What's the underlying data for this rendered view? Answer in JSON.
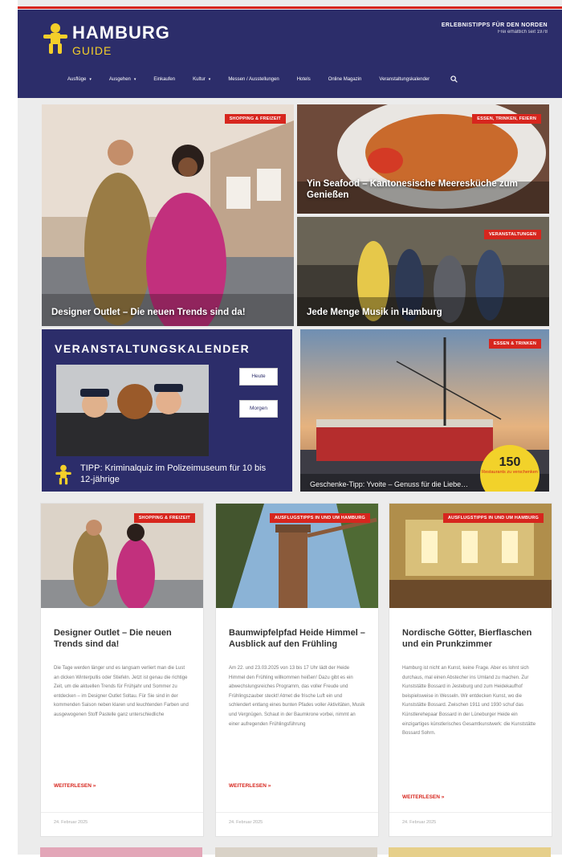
{
  "brand": {
    "name": "HAMBURG",
    "sub": "GUIDE",
    "tagline": "ERLEBNISTIPPS FÜR DEN NORDEN",
    "tagline_sub": "Frei erhältlich seit 1978"
  },
  "nav": {
    "items": [
      "Ausflüge",
      "Ausgehen",
      "Einkaufen",
      "Kultur",
      "Messen / Ausstellungen",
      "Hotels",
      "Online Magazin",
      "Veranstaltungskalender"
    ],
    "dropdown": [
      true,
      true,
      false,
      true,
      false,
      false,
      false,
      false
    ],
    "search_icon": "search-icon"
  },
  "hero": {
    "main": {
      "badge": "SHOPPING & FREIZEIT",
      "title": "Designer Outlet – Die neuen Trends sind da!"
    },
    "top_right": {
      "badge": "ESSEN, TRINKEN, FEIERN",
      "title": "Yin Seafood – Kantonesische Meeresküche zum Genießen"
    },
    "mid_right": {
      "badge": "VERANSTALTUNGEN",
      "title": "Jede Menge Musik in Hamburg"
    }
  },
  "calendar": {
    "title": "VERANSTALTUNGSKALENDER",
    "btn_today": "Heute",
    "btn_tomorrow": "Morgen",
    "tip": "TIPP: Kriminalquiz im Polizeimuseum für 10 bis 12-jährige"
  },
  "promo": {
    "badge": "ESSEN & TRINKEN",
    "caption": "Geschenke-Tipp: Yvoite – Genuss für die Liebe…",
    "disc_number": "150",
    "disc_text": "Restaurants zu verschenken"
  },
  "posts": [
    {
      "badge": "SHOPPING & FREIZEIT",
      "title": "Designer Outlet – Die neuen Trends sind da!",
      "excerpt": "Die Tage werden länger und es langsam verliert man die Lust an dicken Winterpullis oder Stiefeln. Jetzt ist genau die richtige Zeit, um die aktuellen Trends für Frühjahr und Sommer zu entdecken – im Designer Outlet Soltau. Für Sie sind in der kommenden Saison neben klaren und leuchtenden Farben und ausgewogenen Stoff Pastelle ganz unterschiedliche",
      "more": "WEITERLESEN »",
      "date": "24. Februar 2025"
    },
    {
      "badge": "AUSFLUGSTIPPS IN UND UM HAMBURG",
      "title": "Baumwipfelpfad Heide Himmel – Ausblick auf den Frühling",
      "excerpt": "Am 22. und 23.03.2025 von 13 bis 17 Uhr lädt der Heide Himmel den Frühling willkommen heißen! Dazu gibt es ein abwechslungsreiches Programm, das voller Freude und Frühlingszauber steckt! Atmet die frische Luft ein und schlendert entlang eines bunten Pfades voller Aktivitäten, Musik und Vergnügen. Schaut in der Baumkrone vorbei, nimmt an einer aufregenden Frühlingsführung",
      "more": "WEITERLESEN »",
      "date": "24. Februar 2025"
    },
    {
      "badge": "AUSFLUGSTIPPS IN UND UM HAMBURG",
      "title": "Nordische Götter, Bierflaschen und ein Prunkzimmer",
      "excerpt": "Hamburg ist nicht an Kunst, keine Frage. Aber es lohnt sich durchaus, mal einen Abstecher ins Umland zu machen. Zur Kunststätte Bossard in Jesteburg und zum Heidekaufhof beispielsweise in Wesseln. Wir entdecken Kunst, wo die Kunststätte Bossard. Zwischen 1911 und 1930 schuf das Künstlerehepaar Bossard in der Lüneburger Heide ein einzigartiges künstlerisches Gesamtkunstwerk: die Kunststätte Bossard Sohrn.",
      "more": "WEITERLESEN »",
      "date": "24. Februar 2025"
    }
  ],
  "colors": {
    "navy": "#2c2d6a",
    "red": "#d7261e",
    "yellow": "#f2d22a"
  }
}
